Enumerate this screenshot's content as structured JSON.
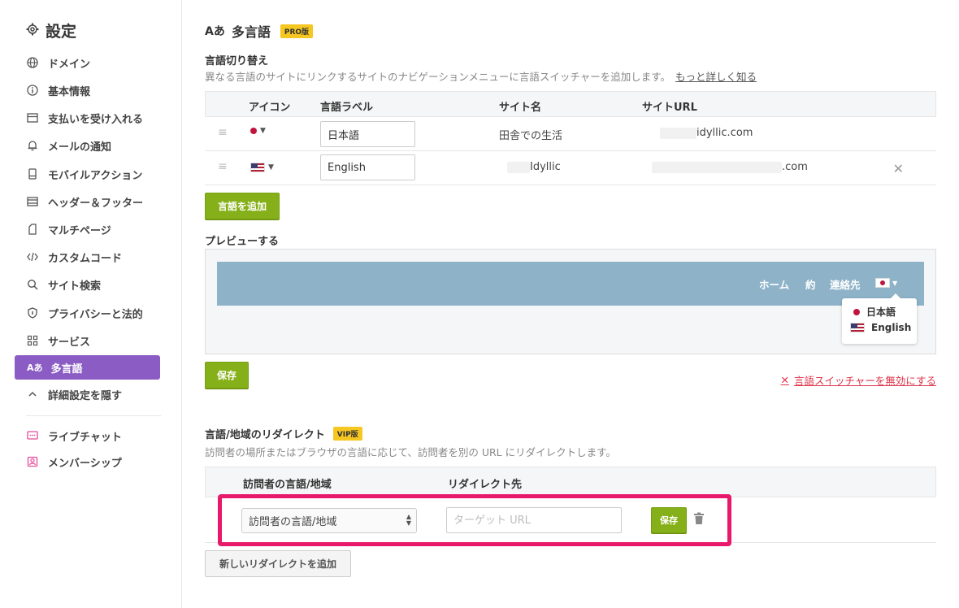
{
  "sidebar": {
    "title": "設定",
    "items": [
      {
        "label": "ドメイン",
        "icon": "globe-icon"
      },
      {
        "label": "基本情報",
        "icon": "info-icon"
      },
      {
        "label": "支払いを受け入れる",
        "icon": "payment-icon"
      },
      {
        "label": "メールの通知",
        "icon": "bell-icon"
      },
      {
        "label": "モバイルアクション",
        "icon": "mobile-icon"
      },
      {
        "label": "ヘッダー＆フッター",
        "icon": "header-footer-icon"
      },
      {
        "label": "マルチページ",
        "icon": "pages-icon"
      },
      {
        "label": "カスタムコード",
        "icon": "code-icon"
      },
      {
        "label": "サイト検索",
        "icon": "search-icon"
      },
      {
        "label": "プライバシーと法的",
        "icon": "shield-icon"
      },
      {
        "label": "サービス",
        "icon": "grid-icon"
      },
      {
        "label": "多言語",
        "icon": "multilingual-icon"
      },
      {
        "label": "詳細設定を隠す",
        "icon": "chevron-up-icon"
      },
      {
        "label": "ライブチャット",
        "icon": "chat-icon"
      },
      {
        "label": "メンバーシップ",
        "icon": "member-icon"
      }
    ],
    "active_index": 11
  },
  "header": {
    "icon_text": "Aあ",
    "title": "多言語",
    "badge": "PRO版"
  },
  "switcher": {
    "title": "言語切り替え",
    "description": "異なる言語のサイトにリンクするサイトのナビゲーションメニューに言語スイッチャーを追加します。",
    "learn_more": "もっと詳しく知る",
    "columns": [
      "アイコン",
      "言語ラベル",
      "サイト名",
      "サイトURL"
    ],
    "rows": [
      {
        "label": "日本語",
        "site_name": "田舎での生活",
        "site_url": "idyllic.com",
        "flag": "jp"
      },
      {
        "label": "English",
        "site_name": "Idyllic",
        "site_url": ".com",
        "flag": "us"
      }
    ],
    "add_button": "言語を追加"
  },
  "preview": {
    "title": "プレビューする",
    "nav": [
      "ホーム",
      "約",
      "連絡先"
    ],
    "dropdown": [
      "日本語",
      "English"
    ],
    "save_button": "保存",
    "disable_link": "言語スイッチャーを無効にする"
  },
  "redirect": {
    "title": "言語/地域のリダイレクト",
    "badge": "VIP版",
    "description": "訪問者の場所またはブラウザの言語に応じて、訪問者を別の URL にリダイレクトします。",
    "columns": [
      "訪問者の言語/地域",
      "リダイレクト先"
    ],
    "select_value": "訪問者の言語/地域",
    "url_placeholder": "ターゲット URL",
    "save_button": "保存",
    "add_button": "新しいリダイレクトを追加"
  },
  "colors": {
    "accent_purple": "#8a5cc4",
    "green": "#86b019",
    "highlight": "#e8196b",
    "badge_yellow": "#f6c621"
  }
}
